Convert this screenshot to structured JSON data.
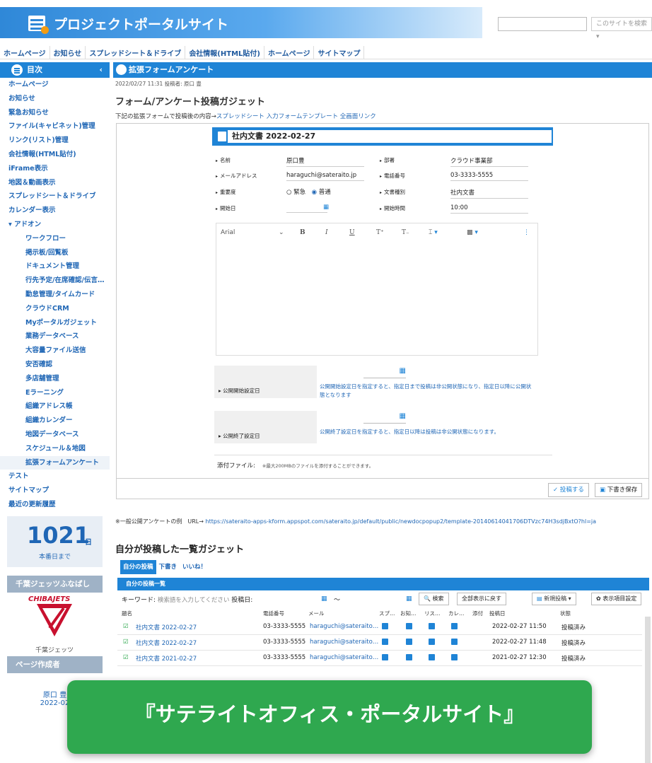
{
  "header": {
    "title": "プロジェクトポータルサイト",
    "search_placeholder": "このサイトを検索 ▾"
  },
  "topnav": [
    "ホームページ",
    "お知らせ",
    "スプレッドシート＆ドライブ",
    "会社情報(HTML貼付)",
    "ホームページ",
    "サイトマップ"
  ],
  "sidebar": {
    "title": "目次",
    "collapse": "‹",
    "items": [
      "ホームページ",
      "お知らせ",
      "緊急お知らせ",
      "ファイル(キャビネット)管理",
      "リンク(リスト)管理",
      "会社情報(HTML貼付)",
      "iFrame表示",
      "地図＆動画表示",
      "スプレッドシート＆ドライブ",
      "カレンダー表示"
    ],
    "addon": "▾ アドオン",
    "subitems": [
      "ワークフロー",
      "掲示板/回覧板",
      "ドキュメント管理",
      "行先予定/在席確認/伝言…",
      "勤怠管理/タイムカード",
      "クラウドCRM",
      "Myポータルガジェット",
      "業務データベース",
      "大容量ファイル送信",
      "安否確認",
      "多店舗管理",
      "Eラーニング",
      "組織アドレス帳",
      "組織カレンダー",
      "地図データベース",
      "スケジュール＆地図",
      "拡張フォームアンケート"
    ],
    "tail": [
      "テスト",
      "サイトマップ",
      "最近の更新履歴"
    ],
    "count": "1021",
    "count_unit": "日",
    "count_label": "本番日まで",
    "team_title": "千葉ジェッツふなばし",
    "team_logo": "CHIBAJETS",
    "team_name": "千葉ジェッツ",
    "author_title": "ページ作成者",
    "author_name": "原口 豊",
    "author_date": "2022-02"
  },
  "panel": {
    "title": "拡張フォームアンケート",
    "meta": "2022/02/27 11:31 投稿者: 原口 豊",
    "gadget_title": "フォーム/アンケート投稿ガジェット",
    "desc": "下記の拡張フォームで投稿後の内容→",
    "desc_link": "スプレッドシート 入力フォームテンプレート 全画面リンク"
  },
  "form": {
    "doc_title": "社内文書 2022-02-27",
    "fields": [
      {
        "label": "名前",
        "value": "原口豊"
      },
      {
        "label": "部署",
        "value": "クラウド事業部"
      },
      {
        "label": "メールアドレス",
        "value": "haraguchi@sateraito.jp"
      },
      {
        "label": "電話番号",
        "value": "03-3333-5555"
      },
      {
        "label": "重要度",
        "value": ""
      },
      {
        "label": "文書種別",
        "value": "社内文書"
      },
      {
        "label": "開始日",
        "value": ""
      },
      {
        "label": "開始時間",
        "value": "10:00"
      }
    ],
    "priority_opts": [
      "緊急",
      "普通"
    ],
    "font": "Arial",
    "pub_start_label": "公開開始設定日",
    "pub_start_note1": "公開開始設定日を指定すると、指定日まで投稿は非公開状態になり、指定日以降に公開状",
    "pub_start_note2": "態となります",
    "pub_end_label": "公開終了設定日",
    "pub_end_note": "公開終了設定日を指定すると、指定日以降は投稿は非公開状態になります。",
    "attach_label": "添付ファイル:",
    "attach_note": "※最大200MBのファイルを添付することができます。",
    "post_btn": "✓ 投稿する",
    "draft_btn": "下書き保存"
  },
  "example": {
    "text": "※一般公開アンケートの例　URL→",
    "url": "https://sateraito-apps-kform.appspot.com/sateraito.jp/default/public/newdocpopup2/template-20140614041706DTVzc74H3sdjBxtO?hl=ja"
  },
  "list": {
    "title": "自分が投稿した一覧ガジェット",
    "tabs": [
      "自分の投稿",
      "下書き",
      "いいね！"
    ],
    "bar": "自分の投稿一覧",
    "kw_label": "キーワード:",
    "kw_ph": "検索語を入力してください",
    "date_label": "投稿日:",
    "tilde": "～",
    "search_btn": "🔍 検索",
    "showall_btn": "全部表示に戻す",
    "new_btn": "新規投稿 ▾",
    "cols_btn": "✿ 表示項目設定",
    "headers": [
      "題名",
      "電話番号",
      "メール",
      "スプ…",
      "お知…",
      "リス…",
      "カレ…",
      "添付",
      "投稿日",
      "状態"
    ],
    "rows": [
      {
        "title": "社内文書 2022-02-27",
        "tel": "03-3333-5555",
        "mail": "haraguchi@sateraito…",
        "date": "2022-02-27 11:50",
        "status": "投稿済み"
      },
      {
        "title": "社内文書 2022-02-27",
        "tel": "03-3333-5555",
        "mail": "haraguchi@sateraito…",
        "date": "2022-02-27 11:48",
        "status": "投稿済み"
      },
      {
        "title": "社内文書 2021-02-27",
        "tel": "03-3333-5555",
        "mail": "haraguchi@sateraito…",
        "date": "2021-02-27 12:30",
        "status": "投稿済み"
      }
    ]
  },
  "promo": "『サテライトオフィス・ポータルサイト』"
}
